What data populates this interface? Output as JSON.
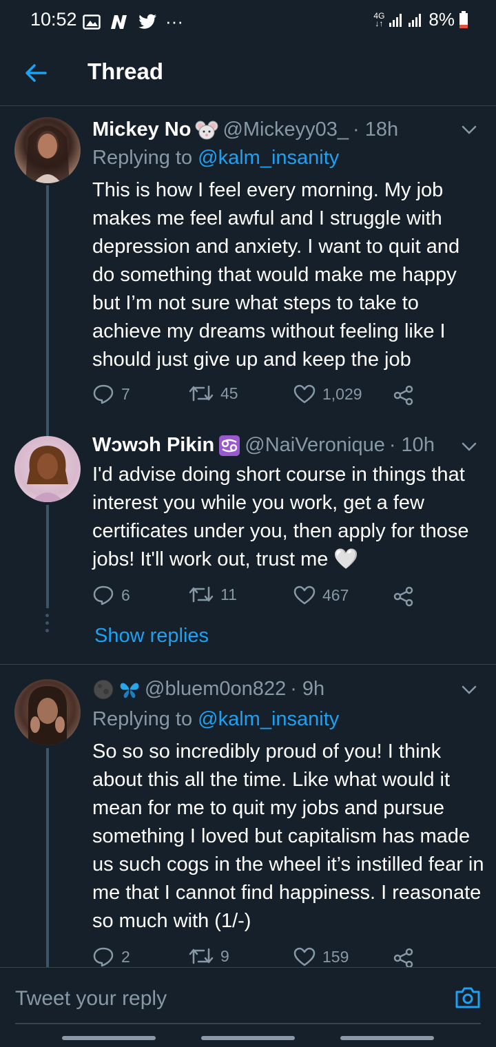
{
  "status_bar": {
    "time": "10:52",
    "network": "4G",
    "battery": "8%"
  },
  "header": {
    "title": "Thread"
  },
  "tweets": [
    {
      "name": "Mickey No",
      "handle": "@Mickeyy03_",
      "time": "· 18h",
      "replying_label": "Replying to",
      "replying_to": "@kalm_insanity",
      "text": "This is how I feel every morning. My job makes me feel awful and I struggle with depression and anxiety. I want to quit and do something that would make me happy but I’m not sure what steps to take to achieve my dreams without feeling like I should just give up and keep the job",
      "replies": "7",
      "retweets": "45",
      "likes": "1,029"
    },
    {
      "name": "Wɔwɔh Pikin",
      "handle": "@NaiVeronique",
      "time": "· 10h",
      "text": "I'd advise doing short course in things that interest you while you work, get a few certificates under you, then apply for those jobs! It'll work out, trust me 🤍",
      "replies": "6",
      "retweets": "11",
      "likes": "467",
      "show_replies": "Show replies"
    },
    {
      "name": "",
      "handle": "@bluem0on822",
      "time": "· 9h",
      "replying_label": "Replying to",
      "replying_to": "@kalm_insanity",
      "text": "So so so incredibly proud of you! I think about this all the time. Like what would it mean for me to quit my jobs and pursue something I loved but capitalism has made us such cogs in the wheel it’s instilled fear in me that I cannot find happiness. I reasonate so much with (1/-)",
      "replies": "2",
      "retweets": "9",
      "likes": "159"
    }
  ],
  "reply_bar": {
    "placeholder": "Tweet your reply"
  },
  "colors": {
    "background": "#15202b",
    "accent": "#1da1f2",
    "secondary_text": "#8899a6",
    "divider": "#38444d"
  },
  "icons": [
    "back-arrow-icon",
    "chevron-down-icon",
    "reply-icon",
    "retweet-icon",
    "like-icon",
    "share-icon",
    "camera-icon",
    "mouse-emoji-icon",
    "cancer-zodiac-icon",
    "moon-emoji-icon",
    "butterfly-emoji-icon"
  ]
}
